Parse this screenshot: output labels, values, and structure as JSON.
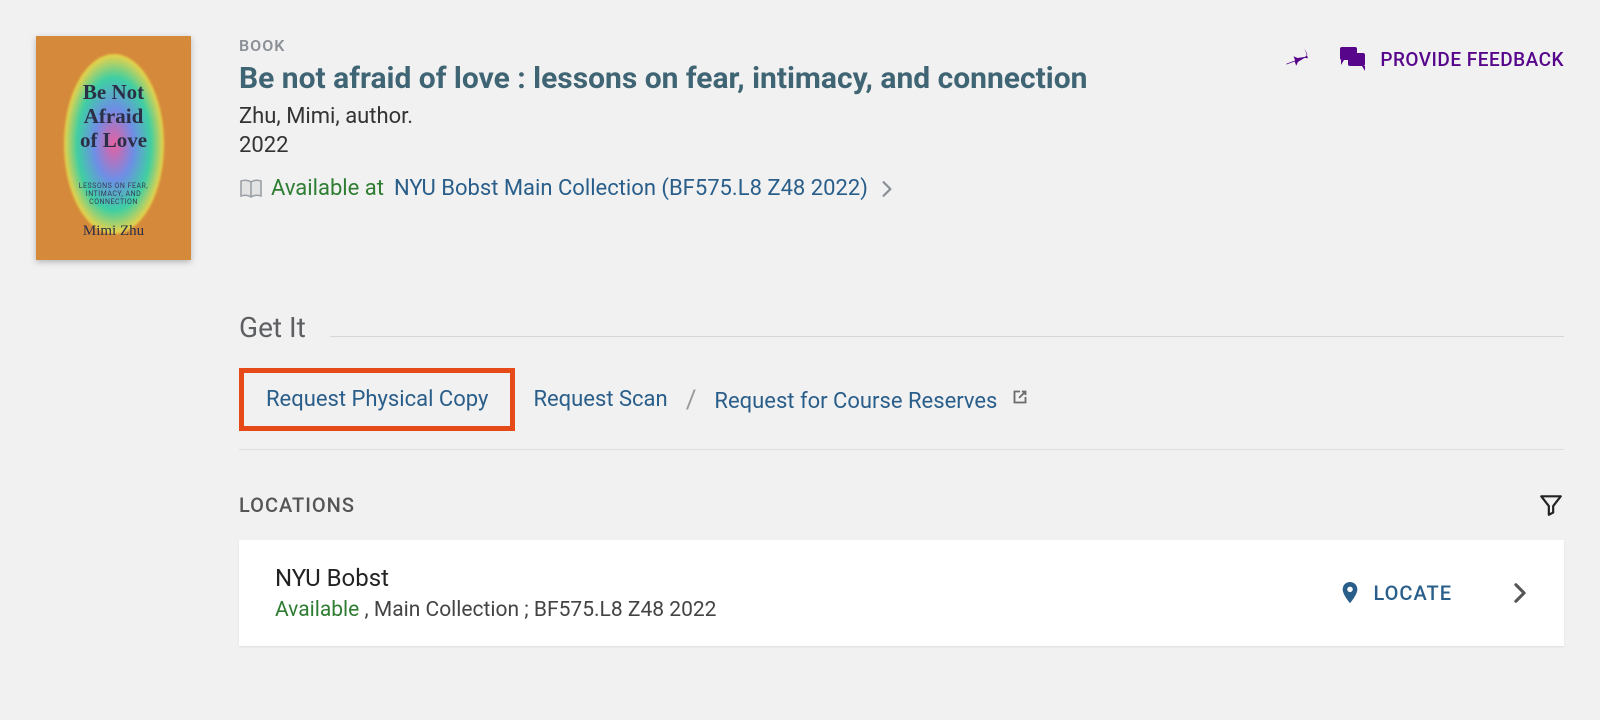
{
  "resource": {
    "type_label": "BOOK",
    "title": "Be not afraid of love : lessons on fear, intimacy, and connection",
    "author_line": "Zhu, Mimi, author.",
    "year": "2022"
  },
  "cover": {
    "title_text": "Be Not\nAfraid\nof Love",
    "subtitle_text": "LESSONS ON FEAR,\nINTIMACY, AND\nCONNECTION",
    "author_text": "Mimi Zhu"
  },
  "availability": {
    "status_text": "Available at",
    "location_link": "NYU Bobst  Main Collection (BF575.L8 Z48 2022)"
  },
  "topbar": {
    "feedback_label": "PROVIDE FEEDBACK"
  },
  "getit": {
    "heading": "Get It",
    "request_physical": "Request Physical Copy",
    "request_scan": "Request Scan",
    "request_reserves": "Request for Course Reserves"
  },
  "locations": {
    "heading": "LOCATIONS",
    "items": [
      {
        "name": "NYU Bobst",
        "status": "Available",
        "detail": " , Main Collection ; BF575.L8 Z48 2022",
        "locate_label": "LOCATE"
      }
    ]
  },
  "colors": {
    "accent_purple": "#57068c",
    "link_blue": "#2a5e8a",
    "avail_green": "#2e7d32",
    "highlight_red": "#e64a19"
  }
}
